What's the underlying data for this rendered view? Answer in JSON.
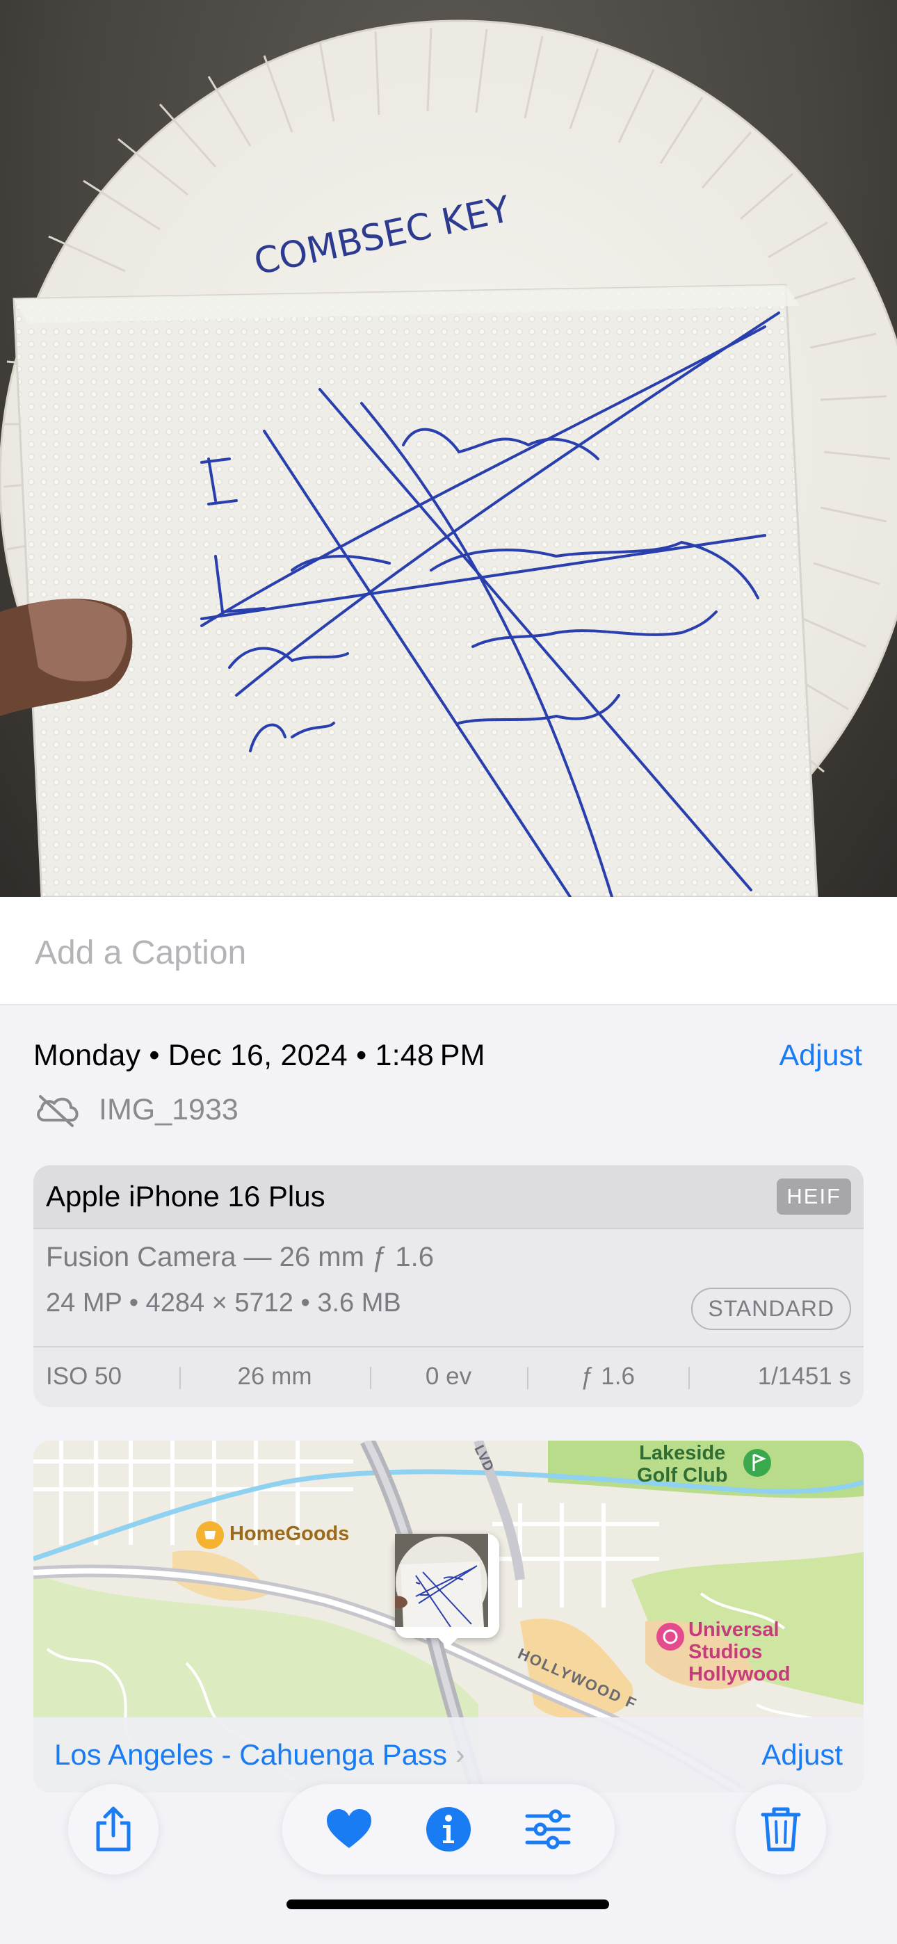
{
  "caption": {
    "placeholder": "Add a Caption"
  },
  "info": {
    "datetime": "Monday • Dec 16, 2024 • 1:48 PM",
    "adjust_label": "Adjust",
    "file_name": "IMG_1933",
    "cloud_icon": "cloud-slash-icon"
  },
  "camera": {
    "device": "Apple iPhone 16 Plus",
    "format_badge": "HEIF",
    "lens": "Fusion Camera — 26 mm ƒ 1.6",
    "specs": "24 MP • 4284 × 5712 • 3.6 MB",
    "profile_badge": "STANDARD",
    "exif": [
      "ISO 50",
      "26 mm",
      "0 ev",
      "ƒ 1.6",
      "1/1451 s"
    ]
  },
  "map": {
    "pois": {
      "homegoods": "HomeGoods",
      "lakeside_line1": "Lakeside",
      "lakeside_line2": "Golf Club",
      "universal_line1": "Universal",
      "universal_line2": "Studios",
      "universal_line3": "Hollywood"
    },
    "roads": {
      "hollywood": "HOLLYWOOD F",
      "blvd": "LVD"
    },
    "location": "Los Angeles - Cahuenga Pass",
    "adjust_label": "Adjust"
  },
  "toolbar": {
    "share_icon": "share-icon",
    "favorite_icon": "heart-icon",
    "info_icon": "info-icon",
    "edit_icon": "sliders-icon",
    "delete_icon": "trash-icon"
  },
  "photo": {
    "plate_writing": "COMBSEC KEY",
    "napkin_writing": [
      "I",
      "fucking",
      "hate",
      "programming,",
      "code",
      "compilation,",
      "poor",
      "execs"
    ]
  },
  "colors": {
    "accent": "#1a7cf3",
    "background": "#f2f2f7"
  }
}
